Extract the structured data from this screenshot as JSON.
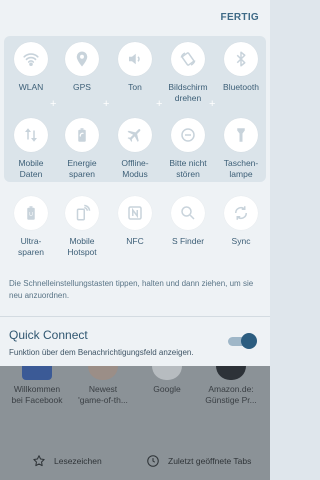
{
  "header": {
    "done_label": "FERTIG"
  },
  "tiles": [
    {
      "label": "WLAN",
      "icon": "wifi-icon"
    },
    {
      "label": "GPS",
      "icon": "location-pin-icon"
    },
    {
      "label": "Ton",
      "icon": "speaker-icon"
    },
    {
      "label": "Bildschirm\ndrehen",
      "icon": "rotate-screen-icon"
    },
    {
      "label": "Bluetooth",
      "icon": "bluetooth-icon"
    },
    {
      "label": "Mobile\nDaten",
      "icon": "mobile-data-icon"
    },
    {
      "label": "Energie\nsparen",
      "icon": "battery-saver-icon"
    },
    {
      "label": "Offline-\nModus",
      "icon": "airplane-icon"
    },
    {
      "label": "Bitte nicht\nstören",
      "icon": "do-not-disturb-icon"
    },
    {
      "label": "Taschen-\nlampe",
      "icon": "flashlight-icon"
    },
    {
      "label": "Ultra-\nsparen",
      "icon": "ultra-battery-saver-icon"
    },
    {
      "label": "Mobile\nHotspot",
      "icon": "hotspot-icon"
    },
    {
      "label": "NFC",
      "icon": "nfc-icon"
    },
    {
      "label": "S Finder",
      "icon": "search-icon"
    },
    {
      "label": "Sync",
      "icon": "sync-icon"
    }
  ],
  "hint_text": "Die Schnelleinstellungstasten tippen, halten und dann ziehen, um sie neu anzuordnen.",
  "quick_connect": {
    "title": "Quick Connect",
    "description": "Funktion über dem Benachrichtigungsfeld anzeigen.",
    "enabled": true
  },
  "shortcuts": [
    {
      "label": "Willkommen\nbei Facebook"
    },
    {
      "label": "Newest\n'game-of-th..."
    },
    {
      "label": "Google"
    },
    {
      "label": "Amazon.de:\nGünstige Pr..."
    }
  ],
  "bottom_bar": {
    "bookmarks_label": "Lesezeichen",
    "recent_tabs_label": "Zuletzt geöffnete Tabs"
  },
  "colors": {
    "accent": "#2c5d80",
    "tile_text": "#3d5f77",
    "panel_bg": "#eef2f5"
  }
}
